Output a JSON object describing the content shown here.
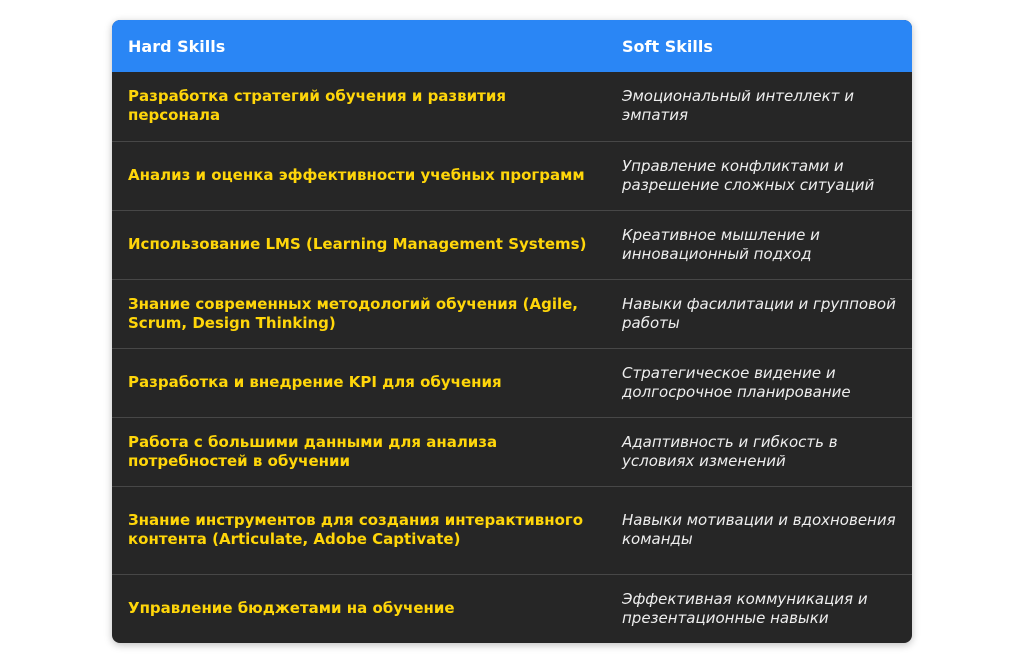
{
  "headers": {
    "hard": "Hard Skills",
    "soft": "Soft Skills"
  },
  "rows": [
    {
      "hard": "Разработка стратегий обучения и развития персонала",
      "soft": "Эмоциональный интеллект и эмпатия"
    },
    {
      "hard": "Анализ и оценка эффективности учебных программ",
      "soft": "Управление конфликтами и разрешение сложных ситуаций"
    },
    {
      "hard": "Использование LMS (Learning Management Systems)",
      "soft": "Креативное мышление и инновационный подход"
    },
    {
      "hard": "Знание современных методологий обучения (Agile, Scrum, Design Thinking)",
      "soft": "Навыки фасилитации и групповой работы"
    },
    {
      "hard": "Разработка и внедрение KPI для обучения",
      "soft": "Стратегическое видение и долгосрочное планирование"
    },
    {
      "hard": "Работа с большими данными для анализа потребностей в обучении",
      "soft": "Адаптивность и гибкость в условиях изменений"
    },
    {
      "hard": "Знание инструментов для создания интерактивного контента (Articulate, Adobe Captivate)",
      "soft": "Навыки мотивации и вдохновения команды"
    },
    {
      "hard": "Управление бюджетами на обучение",
      "soft": "Эффективная коммуникация и презентационные навыки"
    }
  ],
  "colors": {
    "header_bg": "#2a86f5",
    "body_bg": "#262626",
    "hard_text": "#ffd60a",
    "soft_text": "#eeeeee"
  }
}
